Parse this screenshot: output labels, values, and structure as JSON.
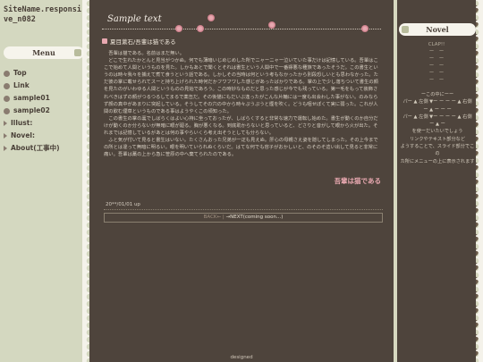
{
  "site": {
    "name": "SiteName.responsive_n082"
  },
  "menu": {
    "title": "Menu",
    "items": [
      {
        "label": "Top",
        "type": "bullet"
      },
      {
        "label": "Link",
        "type": "bullet"
      },
      {
        "label": "sample01",
        "type": "bullet"
      },
      {
        "label": "sample02",
        "type": "bullet"
      },
      {
        "label": "Illust:",
        "type": "arrow"
      },
      {
        "label": "Novel:",
        "type": "arrow"
      },
      {
        "label": "About(工事中)",
        "type": "arrow"
      }
    ]
  },
  "header": {
    "title": "Sample text"
  },
  "post": {
    "title": "夏目漱石/吾輩は猫である",
    "body": "　吾輩は猫である。名前はまだ無い。\n　どこで生れたかとんと見当がつかぬ。何でも薄暗いじめじめした所でニャーニャー泣いていた事だけは記憶している。吾輩はここで始めて人間というものを見た。しかもあとで聞くとそれは書生という人間中で一番獰悪な種族であったそうだ。この書生というのは時々我々を捕えて煮て食うという話である。しかしその当時は何という考もなかったから別段恐しいとも思わなかった。ただ彼の掌に載せられてスーと持ち上げられた時何だかフワフワした感じがあったばかりである。掌の上で少し落ちついて書生の顔を見たのがいわゆる人間というものの見始であろう。この時妙なものだと思った感じが今でも残っている。第一毛をもって装飾されべきはずの顔がつるつるしてまるで薬缶だ。その後猫にもだいぶ逢ったがこんな片輪には一度も出会わした事がない。のみならず顔の真中があまりに突起している。そうしてその穴の中から時々ぷうぷうと煙を吹く。どうも咽せぽくて実に弱った。これが人間の飲む煙草というものである事はようやくこの頃知った。\n　この書生の掌の裏でしばらくはよい心持に坐っておったが、しばらくすると非常な速力で運転し始めた。書生が動くのか自分だけが動くのか分らないが無暗に眼が廻る。胸が悪くなる。到底助からないと思っていると、どさりと音がして眼から火が出た。それまでは記憶しているがあとは何の事やらいくら考え出そうとしても分らない。\n　ふと気が付いて見ると書生はいない。たくさんおった兄弟が一疋も見えぬ。肝心の母親さえ姿を隠してしまった。その上今までの所とは違って無暗に明るい。眼を明いていられぬくらいだ。はてな何でも容子がおかしいと、のそのそ這い出して見ると非常に痛い。吾輩は藁の上から急に笹原の中へ棄てられたのである。",
    "footer": "吾輩は猫である",
    "date": "20**/01/01 up"
  },
  "pager": {
    "back": "BACK←",
    "separator": "|",
    "next": "→NEXT(coming soon...)"
  },
  "footer": {
    "designed": "designed"
  },
  "novel": {
    "title": "Novel",
    "items": [
      "CLAP!!",
      "ー　ー",
      "ー　ー",
      "ー　ー",
      "ー　ー",
      "ー　ー"
    ],
    "info_lines": [
      "ーこの中にーー",
      "パー ▲ 左側 ▼ー ー ー ー ▲ 右側",
      "ー ▲ ー ー ー",
      "パー ▲ 左側 ▼ー ー ー ー ▲ 右側",
      "ー ▲ ー",
      "を使ーだいたいでしょう",
      "リンクやテキスト部分など",
      "ようすることで、スライド部分でこの",
      "カ所にメニューの上に表示されます"
    ]
  }
}
